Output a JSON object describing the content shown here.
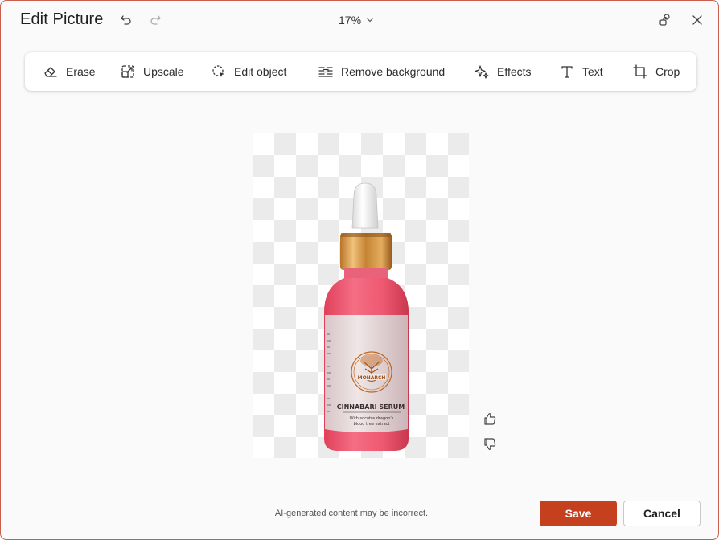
{
  "window": {
    "title": "Edit Picture",
    "zoom_level": "17%"
  },
  "header": {
    "undo_icon": "undo-icon",
    "redo_icon": "redo-icon",
    "zoom_dropdown_icon": "chevron-down-icon",
    "share_icon": "people-icon",
    "close_icon": "close-icon"
  },
  "toolbar": {
    "items": [
      {
        "label": "Erase",
        "icon": "eraser-icon"
      },
      {
        "label": "Upscale",
        "icon": "upscale-icon"
      },
      {
        "label": "Edit object",
        "icon": "edit-object-icon"
      },
      {
        "label": "Remove background",
        "icon": "remove-background-icon"
      },
      {
        "label": "Effects",
        "icon": "sparkle-icon"
      },
      {
        "label": "Text",
        "icon": "text-icon"
      },
      {
        "label": "Crop",
        "icon": "crop-icon"
      }
    ]
  },
  "image": {
    "product_brand": "MONARCH",
    "product_name": "CINNABARI SERUM",
    "product_tagline_1": "With socotra dragon's",
    "product_tagline_2": "blood tree extract"
  },
  "feedback": {
    "like_icon": "thumbs-up-icon",
    "dislike_icon": "thumbs-down-icon"
  },
  "footer": {
    "disclaimer": "AI-generated content may be incorrect.",
    "save_label": "Save",
    "cancel_label": "Cancel"
  },
  "colors": {
    "accent": "#c4401f",
    "dialog_border": "#c9604f",
    "background": "#fafafa"
  }
}
